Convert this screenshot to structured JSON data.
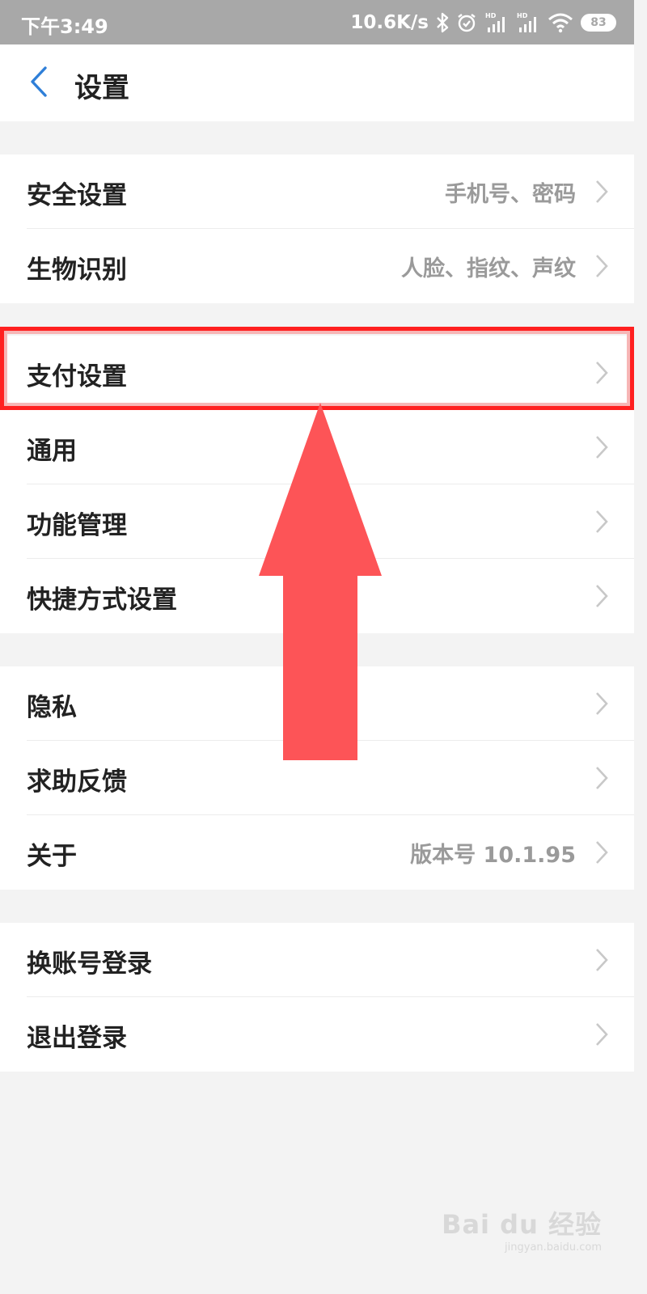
{
  "status_bar": {
    "time": "下午3:49",
    "network_speed": "10.6K/s",
    "battery": "83",
    "icons": [
      "bluetooth-icon",
      "alarm-icon",
      "signal-hd-icon",
      "signal-hd-icon",
      "wifi-icon",
      "battery-icon"
    ]
  },
  "nav": {
    "back_icon": "chevron-left-icon",
    "title": "设置"
  },
  "groups": [
    {
      "items": [
        {
          "label": "安全设置",
          "value": "手机号、密码"
        },
        {
          "label": "生物识别",
          "value": "人脸、指纹、声纹"
        }
      ]
    },
    {
      "items": [
        {
          "label": "支付设置",
          "value": ""
        },
        {
          "label": "通用",
          "value": ""
        },
        {
          "label": "功能管理",
          "value": ""
        },
        {
          "label": "快捷方式设置",
          "value": ""
        }
      ]
    },
    {
      "items": [
        {
          "label": "隐私",
          "value": ""
        },
        {
          "label": "求助反馈",
          "value": ""
        },
        {
          "label": "关于",
          "value": "版本号 10.1.95"
        }
      ]
    },
    {
      "items": [
        {
          "label": "换账号登录",
          "value": ""
        },
        {
          "label": "退出登录",
          "value": ""
        }
      ]
    }
  ],
  "annotation": {
    "highlighted_item": "支付设置",
    "highlight_color": "#ff2020",
    "arrow_color": "#fd5457"
  },
  "watermark": {
    "brand": "Bai du 经验",
    "url": "jingyan.baidu.com"
  },
  "colors": {
    "status_bar_bg": "#a8a8a8",
    "page_bg": "#f3f3f3",
    "accent_blue": "#2f7fd8",
    "label_text": "#222222",
    "value_text": "#9a9a9a"
  }
}
